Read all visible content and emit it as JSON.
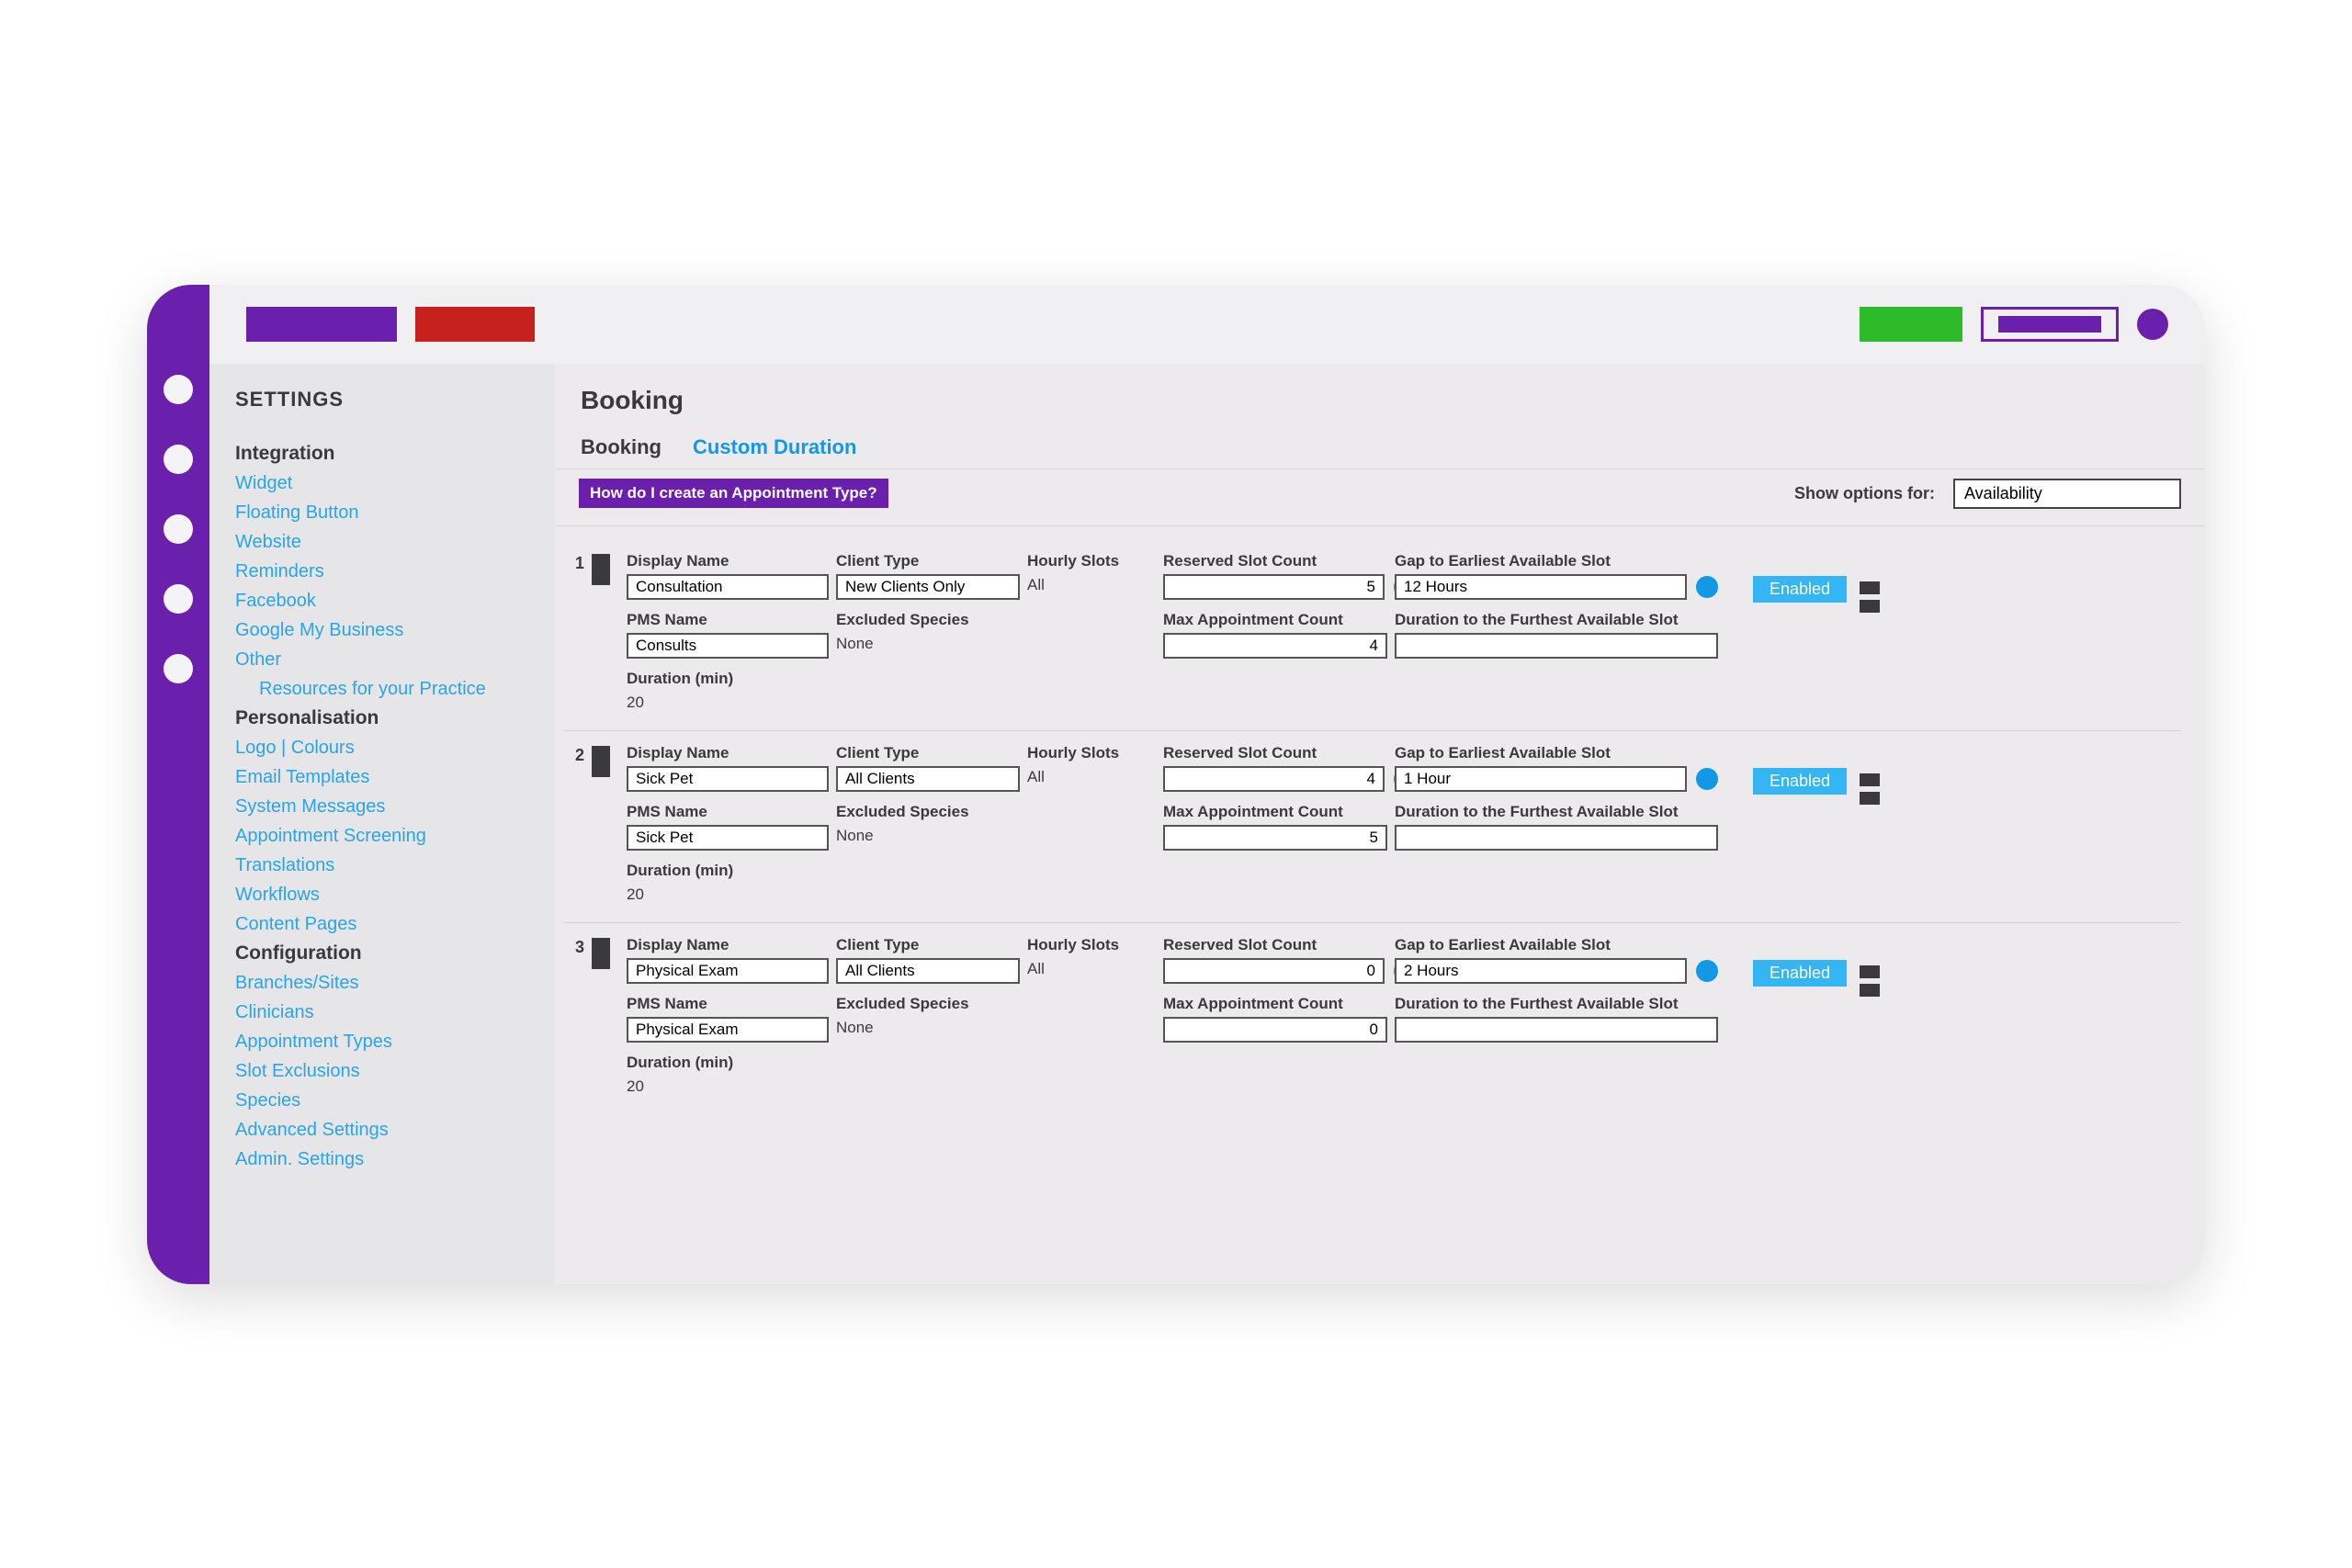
{
  "toolbar": {},
  "sidebar": {
    "title": "SETTINGS",
    "groups": {
      "integration": {
        "heading": "Integration",
        "items": [
          "Widget",
          "Floating Button",
          "Website",
          "Reminders",
          "Facebook",
          "Google My Business",
          "Other",
          "Resources for your Practice"
        ]
      },
      "personalisation": {
        "heading": "Personalisation",
        "items": [
          "Logo | Colours",
          "Email Templates",
          "System Messages",
          "Appointment Screening",
          "Translations",
          "Workflows",
          "Content Pages"
        ]
      },
      "configuration": {
        "heading": "Configuration",
        "items": [
          "Branches/Sites",
          "Clinicians",
          "Appointment Types",
          "Slot Exclusions",
          "Species",
          "Advanced Settings",
          "Admin. Settings"
        ]
      }
    }
  },
  "main": {
    "title": "Booking",
    "tabs": {
      "booking": "Booking",
      "custom": "Custom Duration"
    },
    "help": "How do I create an Appointment Type?",
    "show_label": "Show options for:",
    "show_value": "Availability",
    "columns": {
      "display_name": "Display Name",
      "pms_name": "PMS Name",
      "duration": "Duration (min)",
      "client_type": "Client Type",
      "excluded_species": "Excluded Species",
      "hourly_slots": "Hourly Slots",
      "reserved_slot_count": "Reserved Slot Count",
      "max_appt_count": "Max Appointment Count",
      "gap_earliest": "Gap to Earliest Available Slot",
      "duration_furthest": "Duration to the Furthest Available Slot",
      "enabled": "Enabled"
    },
    "rows": [
      {
        "idx": "1",
        "display_name": "Consultation",
        "pms_name": "Consults",
        "duration": "20",
        "client_type": "New Clients Only",
        "excluded_species": "None",
        "hourly_slots": "All",
        "reserved_slot_count": "5",
        "max_appt_count": "4",
        "gap_earliest": "12 Hours",
        "duration_furthest": "",
        "enabled": "Enabled"
      },
      {
        "idx": "2",
        "display_name": "Sick Pet",
        "pms_name": "Sick Pet",
        "duration": "20",
        "client_type": "All Clients",
        "excluded_species": "None",
        "hourly_slots": "All",
        "reserved_slot_count": "4",
        "max_appt_count": "5",
        "gap_earliest": "1 Hour",
        "duration_furthest": "",
        "enabled": "Enabled"
      },
      {
        "idx": "3",
        "display_name": "Physical Exam",
        "pms_name": "Physical Exam",
        "duration": "20",
        "client_type": "All Clients",
        "excluded_species": "None",
        "hourly_slots": "All",
        "reserved_slot_count": "0",
        "max_appt_count": "0",
        "gap_earliest": "2 Hours",
        "duration_furthest": "",
        "enabled": "Enabled"
      }
    ]
  }
}
